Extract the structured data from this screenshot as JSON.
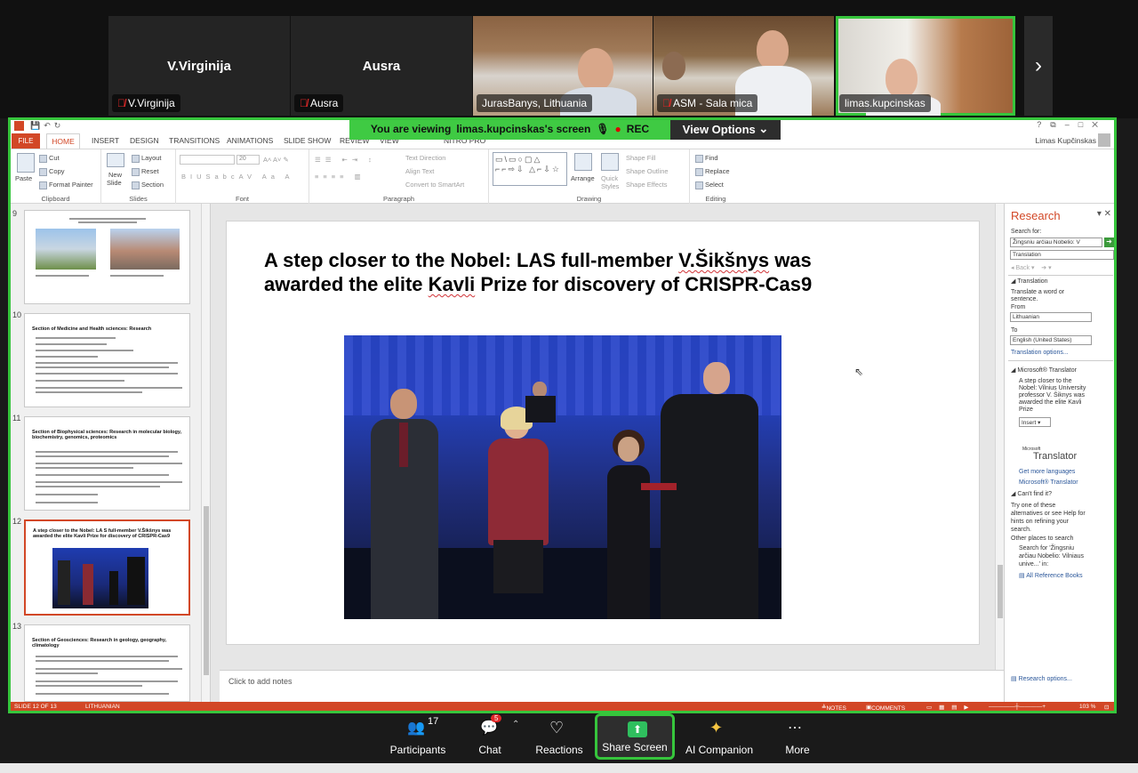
{
  "participants": {
    "tiles": [
      {
        "name": "V.Virginija",
        "label": "V.Virginija",
        "muted": true
      },
      {
        "name": "Ausra",
        "label": "Ausra",
        "muted": true
      },
      {
        "label": "JurasBanys, Lithuania",
        "muted": false
      },
      {
        "label": "ASM - Sala mica",
        "muted": true
      },
      {
        "label": "limas.kupcinskas",
        "muted": false,
        "active": true
      }
    ],
    "next_icon": "chevron-right-icon"
  },
  "share": {
    "viewing_prefix": "You are viewing",
    "viewing_name": "limas.kupcinskas's screen",
    "rec_label": "REC",
    "view_options": "View Options"
  },
  "ppt": {
    "tabs": {
      "file": "FILE",
      "home": "HOME",
      "insert": "INSERT",
      "design": "DESIGN",
      "transitions": "TRANSITIONS",
      "animations": "ANIMATIONS",
      "slideshow": "SLIDE SHOW",
      "review": "REVIEW",
      "view": "VIEW",
      "nitro": "NITRO PRO"
    },
    "user": "Limas Kupčinskas",
    "ribbon": {
      "paste": "Paste",
      "cut": "Cut",
      "copy": "Copy",
      "format_painter": "Format Painter",
      "clipboard": "Clipboard",
      "new_slide": "New",
      "new_slide2": "Slide",
      "layout": "Layout",
      "reset": "Reset",
      "section": "Section",
      "slides": "Slides",
      "font_size": "20",
      "font": "Font",
      "text_direction": "Text Direction",
      "align_text": "Align Text",
      "convert_smartart": "Convert to SmartArt",
      "paragraph": "Paragraph",
      "arrange": "Arrange",
      "quick_styles": "Quick",
      "quick_styles2": "Styles",
      "shape_fill": "Shape Fill",
      "shape_outline": "Shape Outline",
      "shape_effects": "Shape Effects",
      "drawing": "Drawing",
      "find": "Find",
      "replace": "Replace",
      "select": "Select",
      "editing": "Editing"
    },
    "thumbs": [
      {
        "num": "9"
      },
      {
        "num": "10",
        "title": "Section of Medicine and Health sciences: Research"
      },
      {
        "num": "11",
        "title": "Section of Biophysical sciences: Research in molecular biology, biochemistry, genomics, proteomics"
      },
      {
        "num": "12",
        "title": "A step closer to the Nobel: LA S full-member V.Šikšnys was awarded the elite Kavli Prize for discovery of CRISPR-Cas9"
      },
      {
        "num": "13",
        "title": "Section of Geosciences: Research in geology, geography, climatology"
      }
    ],
    "slide": {
      "title_line1_pre": "A step closer to the Nobel: LAS full-member ",
      "title_line1_name": "V.Šikšnys",
      "title_line1_post": " was",
      "title_line2_pre": "awarded the elite ",
      "title_line2_kavli": "Kavli",
      "title_line2_post": " Prize for discovery of ",
      "title_line2_crispr": "CRISPR-Cas9"
    },
    "notes_placeholder": "Click to add notes",
    "research": {
      "title": "Research",
      "search_for": "Search for:",
      "search_value": "Žingsniu arčiau Nobelio: V",
      "service": "Translation",
      "back": "Back",
      "translation_header": "Translation",
      "translate_hint1": "Translate a word or",
      "translate_hint2": "sentence.",
      "from_label": "From",
      "from_value": "Lithuanian",
      "to_label": "To",
      "to_value": "English (United States)",
      "translation_options": "Translation options...",
      "ms_translator_header": "Microsoft® Translator",
      "result": [
        "A step closer to the",
        "Nobel: Vilnius University",
        "professor V. Šiknys was",
        "awarded the elite Kavli",
        "Prize"
      ],
      "insert": "Insert",
      "ms_logo_small": "Microsoft",
      "translator_logo": "Translator",
      "get_more": "Get more languages",
      "ms_translator_link": "Microsoft® Translator",
      "cant_find": "Can't find it?",
      "try_text": [
        "Try one of these",
        "alternatives or see Help for",
        "hints on refining your",
        "search."
      ],
      "other_places": "Other places to search",
      "search_for_text": [
        "Search for 'Žingsniu",
        "arčiau Nobelio: Vilniaus",
        "unive...' in:"
      ],
      "all_reference": "All Reference Books",
      "research_options": "Research options..."
    },
    "status": {
      "slide_info": "SLIDE 12 OF 13",
      "language": "LITHUANIAN",
      "notes": "NOTES",
      "comments": "COMMENTS",
      "zoom": "103 %"
    }
  },
  "toolbar": {
    "participants_label": "Participants",
    "participants_count": "17",
    "chat_label": "Chat",
    "chat_badge": "5",
    "reactions_label": "Reactions",
    "share_label": "Share Screen",
    "ai_label": "AI Companion",
    "more_label": "More"
  },
  "colors": {
    "active_green": "#36c53c",
    "ppt_orange": "#d24726",
    "mute_red": "#e02828"
  }
}
